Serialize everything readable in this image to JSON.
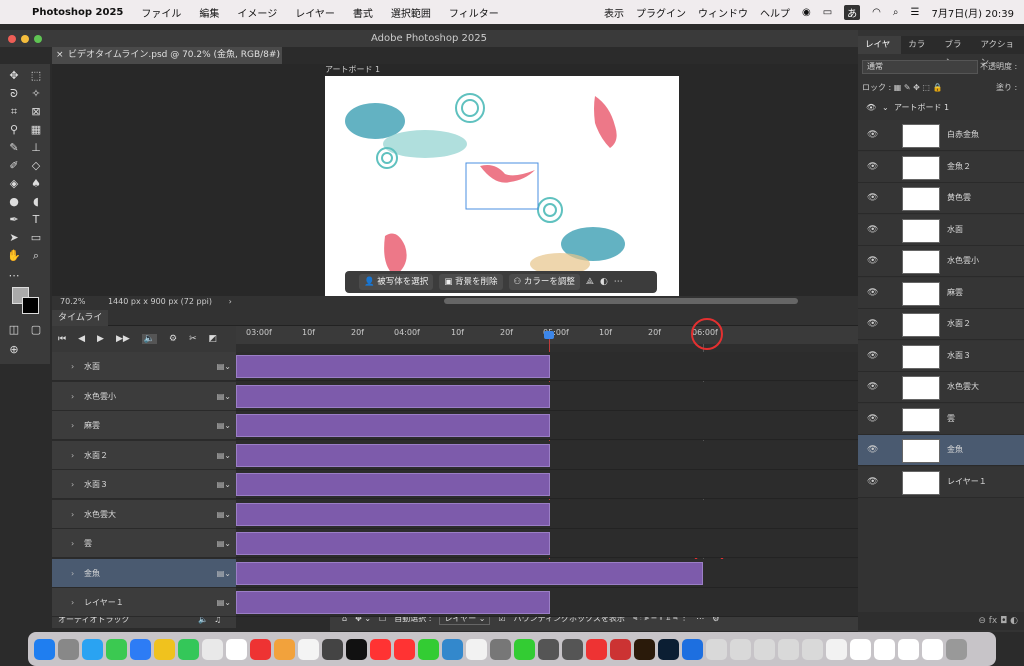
{
  "menubar": {
    "apple": "",
    "app_name": "Photoshop 2025",
    "items": [
      "ファイル",
      "編集",
      "イメージ",
      "レイヤー",
      "書式",
      "選択範囲",
      "フィルター"
    ],
    "right_items": [
      "表示",
      "プラグイン",
      "ウィンドウ",
      "ヘルプ"
    ],
    "input_mode": "あ",
    "datetime": "7月7日(月)  20:39"
  },
  "window": {
    "title": "Adobe Photoshop 2025"
  },
  "document": {
    "tab_title": "ビデオタイムライン.psd @ 70.2% (金魚, RGB/8#) *",
    "artboard_label": "アートボード 1"
  },
  "context_bar": {
    "select_subject": "被写体を選択",
    "remove_bg": "背景を削除",
    "adjust_color": "カラーを調整"
  },
  "status": {
    "zoom": "70.2%",
    "doc_size": "1440 px x 900 px (72 ppi)"
  },
  "timeline": {
    "tab_label": "タイムライン",
    "ruler_ticks": [
      "03:00f",
      "10f",
      "20f",
      "04:00f",
      "10f",
      "20f",
      "05:00f",
      "10f",
      "20f",
      "06:00f"
    ],
    "tracks": [
      "水面",
      "水色雲小",
      "麻雲",
      "水面２",
      "水面３",
      "水色雲大",
      "雲",
      "金魚",
      "レイヤー１"
    ],
    "selected_track": "金魚",
    "audio_track": "オーディオトラック",
    "bars_long_fraction": 0.505
  },
  "options_bar": {
    "auto_select_label": "自動選択 :",
    "auto_select_value": "レイヤー",
    "bounding_box_label": "バウンディングボックスを表示"
  },
  "right_panel": {
    "tabs": [
      "レイヤー",
      "カラー",
      "ブラシ",
      "アクション"
    ],
    "blend_mode": "通常",
    "opacity_label": "不透明度 :",
    "lock_label": "ロック :",
    "fill_label": "塗り :",
    "artboard_name": "アートボード 1",
    "layers": [
      "白赤金魚",
      "金魚２",
      "黄色雲",
      "水面",
      "水色雲小",
      "麻雲",
      "水面２",
      "水面３",
      "水色雲大",
      "雲",
      "金魚",
      "レイヤー１"
    ],
    "selected_layer": "金魚",
    "bottom_icons": "fx"
  },
  "colors": {
    "accent": "#7d5bab",
    "selection": "#4a5a70",
    "highlight_circle": "#e43030",
    "playhead": "#3d86e8"
  }
}
